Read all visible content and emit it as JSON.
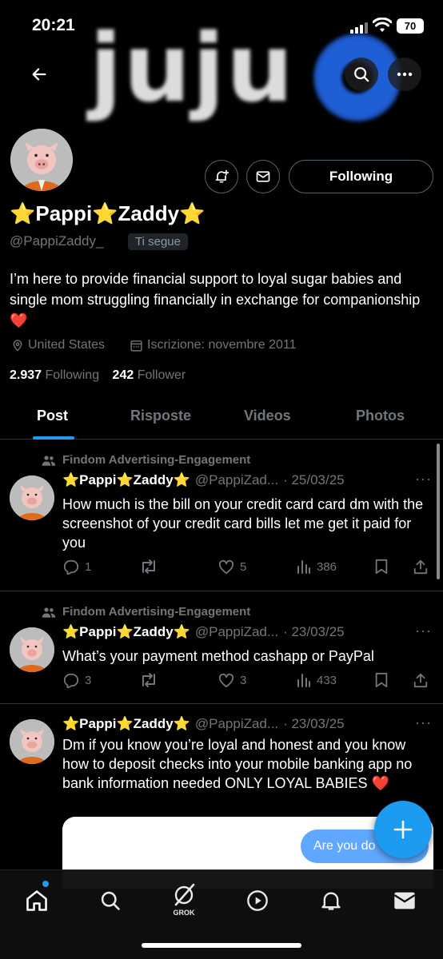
{
  "status_bar": {
    "time": "20:21",
    "battery": "70"
  },
  "banner": {
    "text": "juju"
  },
  "profile": {
    "name": "⭐Pappi⭐Zaddy⭐",
    "handle": "@PappiZaddy_",
    "follows_you_badge": "Ti segue",
    "follow_button_label": "Following",
    "bio": "I’m here to provide financial support to loyal sugar babies and single mom struggling financially in exchange for companionship ❤️",
    "location": "United States",
    "joined": "Iscrizione: novembre 2011",
    "following_count": "2.937",
    "following_label": "Following",
    "follower_count": "242",
    "follower_label": "Follower"
  },
  "tabs": [
    "Post",
    "Risposte",
    "Videos",
    "Photos"
  ],
  "posts": [
    {
      "context": "Findom Advertising-Engagement",
      "name": "⭐Pappi⭐Zaddy⭐",
      "handle": "@PappiZad...",
      "date": "· 25/03/25",
      "text": "How much is the bill on your credit card card dm with the screenshot of your credit card bills let me get it paid for you",
      "replies": "1",
      "reposts": "",
      "likes": "5",
      "views": "386"
    },
    {
      "context": "Findom Advertising-Engagement",
      "name": "⭐Pappi⭐Zaddy⭐",
      "handle": "@PappiZad...",
      "date": "· 23/03/25",
      "text": "What’s your payment method cashapp or PayPal",
      "replies": "3",
      "reposts": "",
      "likes": "3",
      "views": "433"
    },
    {
      "name": "⭐Pappi⭐Zaddy⭐",
      "handle": "@PappiZad...",
      "date": "· 23/03/25",
      "text": "Dm if you know you’re loyal and honest and you know how to deposit checks into your mobile banking app no bank information needed ONLY LOYAL BABIES ❤️",
      "media_bubble_text": "Are you do"
    }
  ],
  "bottom_nav": {
    "grok_label": "GROK"
  },
  "colors": {
    "accent": "#1d9bf0",
    "background": "#000000",
    "muted": "#71767b"
  },
  "icons": [
    "back-arrow-icon",
    "search-icon",
    "more-icon",
    "notify-bell-icon",
    "mail-icon",
    "location-icon",
    "calendar-icon",
    "community-icon",
    "reply-icon",
    "repost-icon",
    "like-icon",
    "views-icon",
    "bookmark-icon",
    "share-icon",
    "plus-icon",
    "home-icon",
    "grok-icon",
    "play-icon",
    "bell-icon"
  ]
}
